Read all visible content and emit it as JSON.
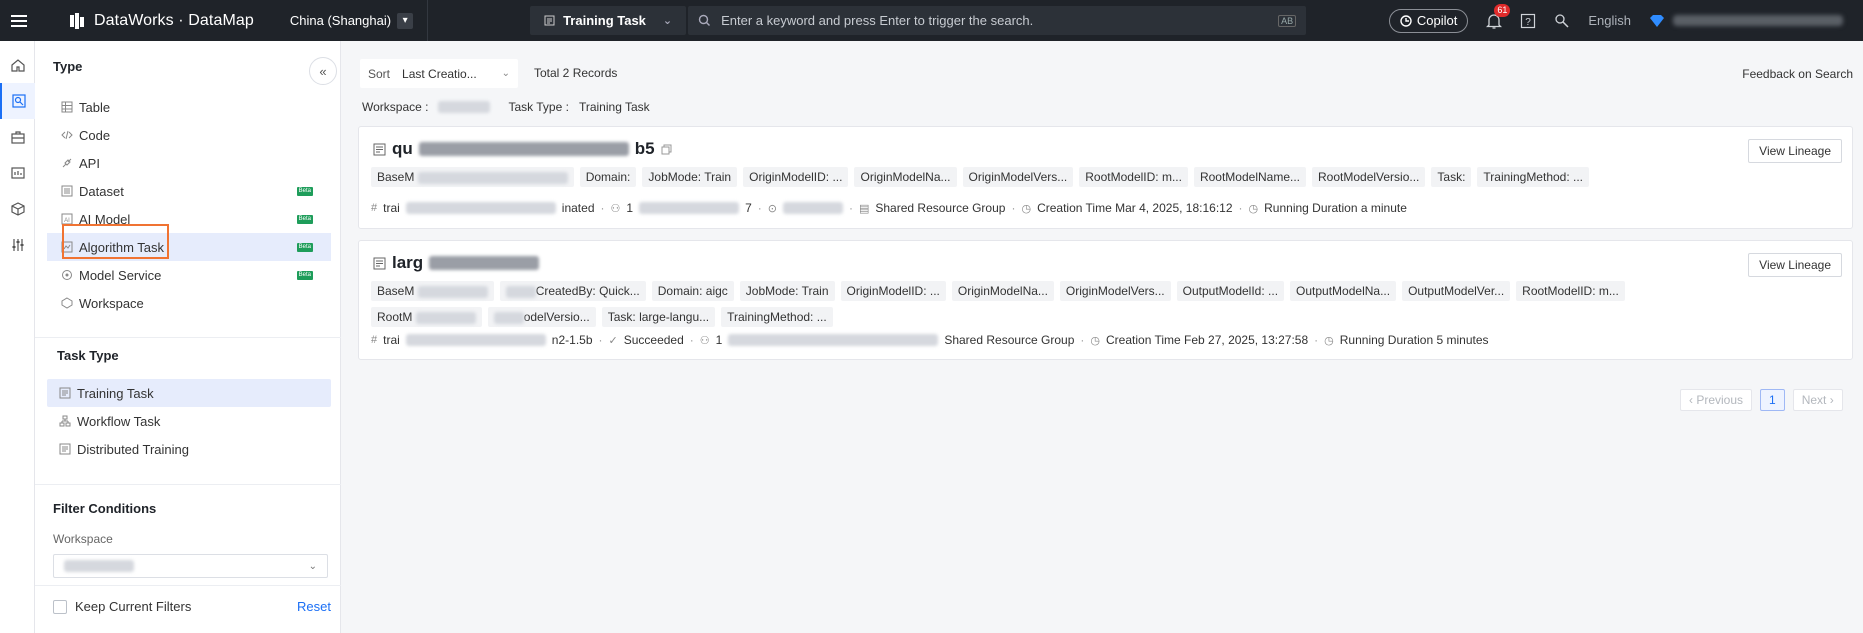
{
  "topbar": {
    "brand": "DataWorks · DataMap",
    "region": "China (Shanghai)",
    "task_type": "Training Task",
    "search_placeholder": "Enter a keyword and press Enter to trigger the search.",
    "copilot": "Copilot",
    "notification_count": "61",
    "language": "English"
  },
  "side": {
    "type_header": "Type",
    "types": [
      {
        "label": "Table",
        "icon": "table-icon",
        "beta": false
      },
      {
        "label": "Code",
        "icon": "code-icon",
        "beta": false
      },
      {
        "label": "API",
        "icon": "api-icon",
        "beta": false
      },
      {
        "label": "Dataset",
        "icon": "dataset-icon",
        "beta": true
      },
      {
        "label": "AI Model",
        "icon": "ai-model-icon",
        "beta": true
      },
      {
        "label": "Algorithm Task",
        "icon": "algorithm-task-icon",
        "beta": true,
        "active": true
      },
      {
        "label": "Model Service",
        "icon": "model-service-icon",
        "beta": true
      },
      {
        "label": "Workspace",
        "icon": "workspace-icon",
        "beta": false
      }
    ],
    "beta_label": "Beta",
    "task_type_header": "Task Type",
    "task_types": [
      {
        "label": "Training Task",
        "active": true
      },
      {
        "label": "Workflow Task"
      },
      {
        "label": "Distributed Training"
      }
    ],
    "filter_header": "Filter Conditions",
    "workspace_label": "Workspace",
    "keep_filters": "Keep Current Filters",
    "reset": "Reset"
  },
  "main": {
    "sort_label": "Sort",
    "sort_value": "Last Creatio...",
    "total": "Total 2 Records",
    "feedback": "Feedback on Search",
    "workspace_filter": "Workspace :",
    "task_type_filter": "Task Type :",
    "task_type_value": "Training Task",
    "view_lineage": "View Lineage",
    "cards": [
      {
        "title_visible_prefix": "qu",
        "title_visible_suffix": "b5",
        "tags": [
          "BaseM",
          "Domain:",
          "JobMode: Train",
          "OriginModelID: ...",
          "OriginModelNa...",
          "OriginModelVers...",
          "RootModelID: m...",
          "RootModelName...",
          "RootModelVersio...",
          "Task:",
          "TrainingMethod: ..."
        ],
        "meta": {
          "name_prefix": "trai",
          "status": "inated",
          "owner_prefix": "1",
          "owner_suffix": "7",
          "resource_group": "Shared Resource Group",
          "creation": "Creation Time Mar 4, 2025, 18:16:12",
          "duration": "Running Duration a minute"
        }
      },
      {
        "title_visible_prefix": "larg",
        "title_visible_suffix": "",
        "tags": [
          "BaseM",
          "CreatedBy: Quick...",
          "Domain: aigc",
          "JobMode: Train",
          "OriginModelID: ...",
          "OriginModelNa...",
          "OriginModelVers...",
          "OutputModelId: ...",
          "OutputModelNa...",
          "OutputModelVer...",
          "RootModelID: m...",
          "RootM",
          "odelVersio...",
          "Task: large-langu...",
          "TrainingMethod: ..."
        ],
        "meta": {
          "name_prefix": "trai",
          "model_suffix": "n2-1.5b",
          "status": "Succeeded",
          "owner_prefix": "1",
          "resource_group": "Shared Resource Group",
          "creation": "Creation Time Feb 27, 2025, 13:27:58",
          "duration": "Running Duration 5 minutes"
        }
      }
    ],
    "pager": {
      "previous": "‹ Previous",
      "current": "1",
      "next": "Next ›"
    }
  }
}
